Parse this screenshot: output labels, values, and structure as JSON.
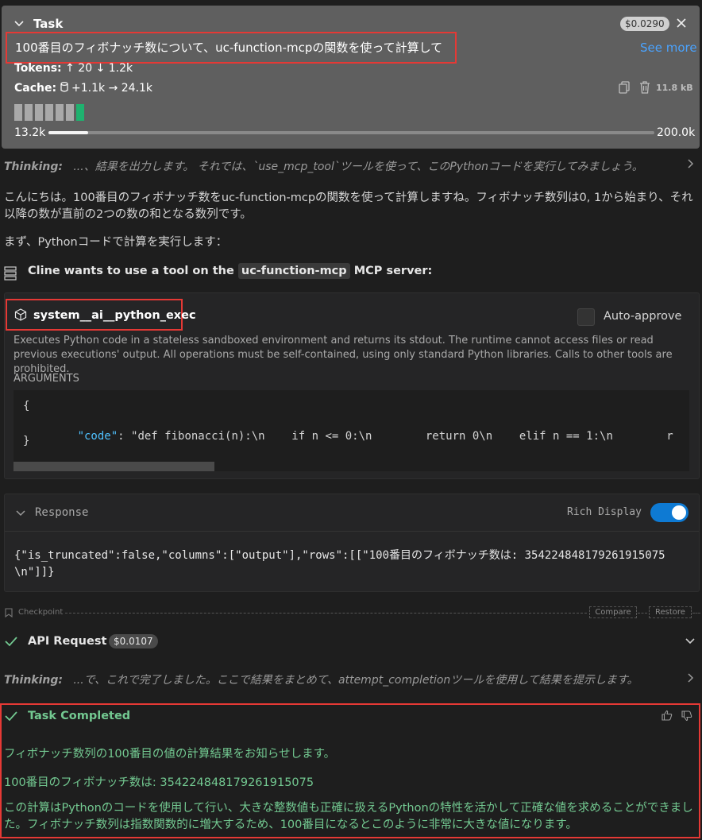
{
  "task": {
    "title": "Task",
    "cost": "$0.0290",
    "prompt": "100番目のフィボナッチ数について、uc-function-mcpの関数を使って計算して",
    "see_more": "See more",
    "tokens_label": "Tokens:",
    "tokens_up": "20",
    "tokens_down": "1.2k",
    "cache_label": "Cache:",
    "cache_write": "+1.1k",
    "cache_read": "24.1k",
    "size": "11.8 kB",
    "context_used": "13.2k",
    "context_max": "200.0k",
    "context_fraction": 0.066
  },
  "thinking1": {
    "label": "Thinking:",
    "text": "...、結果を出力します。 それでは、`use_mcp_tool`ツールを使って、このPythonコードを実行してみましょう。"
  },
  "message": {
    "p1": "こんにちは。100番目のフィボナッチ数をuc-function-mcpの関数を使って計算しますね。フィボナッチ数列は0, 1から始まり、それ以降の数が直前の2つの数の和となる数列です。",
    "p2": "まず、Pythonコードで計算を実行します："
  },
  "mcp": {
    "prefix": "Cline wants to use a tool on the",
    "server": "uc-function-mcp",
    "suffix": "MCP server:",
    "tool_name": "system__ai__python_exec",
    "auto_approve": "Auto-approve",
    "description": "Executes Python code in a stateless sandboxed environment and returns its stdout. The runtime cannot access files or read previous executions' output. All operations must be self-contained, using only standard Python libraries. Calls to other tools are prohibited.",
    "arguments_label": "ARGUMENTS",
    "code_open": "{",
    "code_key": "\"code\"",
    "code_value": ": \"def fibonacci(n):\\n    if n <= 0:\\n        return 0\\n    elif n == 1:\\n        r",
    "code_close": "}"
  },
  "response": {
    "label": "Response",
    "rich_display": "Rich Display",
    "rich_display_on": true,
    "content": "{\"is_truncated\":false,\"columns\":[\"output\"],\"rows\":[[\"100番目のフィボナッチ数は: 354224848179261915075\\n\"]]}"
  },
  "checkpoint": {
    "label": "Checkpoint",
    "compare": "Compare",
    "restore": "Restore"
  },
  "api_request": {
    "label": "API Request",
    "cost": "$0.0107"
  },
  "thinking2": {
    "label": "Thinking:",
    "text": "...で、これで完了しました。ここで結果をまとめて、attempt_completionツールを使用して結果を提示します。"
  },
  "completion": {
    "title": "Task Completed",
    "p1": "フィボナッチ数列の100番目の値の計算結果をお知らせします。",
    "p2": "100番目のフィボナッチ数は: 354224848179261915075",
    "p3": "この計算はPythonのコードを使用して行い、大きな整数値も正確に扱えるPythonの特性を活かして正確な値を求めることができました。フィボナッチ数列は指数関数的に増大するため、100番目になるとこのように非常に大きな値になります。"
  },
  "colors": {
    "accent_red": "#e53935",
    "success_green": "#73c991",
    "toggle_blue": "#0e7ad3",
    "context_green": "#1fb26f"
  }
}
